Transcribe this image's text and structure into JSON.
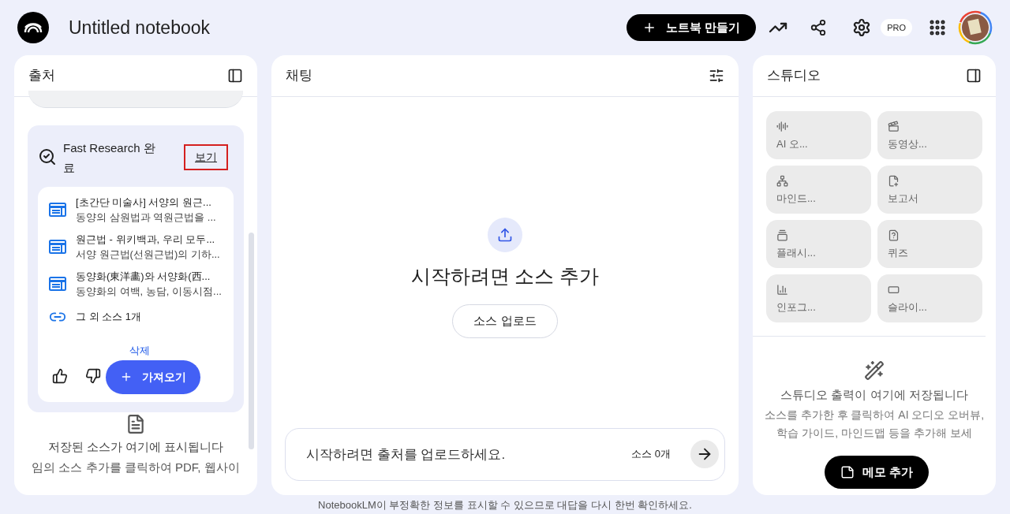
{
  "header": {
    "title": "Untitled notebook",
    "create_button": "노트북 만들기",
    "plan_badge": "PRO"
  },
  "sources": {
    "title": "출처",
    "research": {
      "title": "Fast Research 완료",
      "view_link": "보기",
      "results": [
        {
          "title": "[초간단 미술사] 서양의 원근...",
          "snippet": "동양의 삼원법과 역원근법을 ..."
        },
        {
          "title": "원근법 - 위키백과, 우리 모두...",
          "snippet": "서양 원근법(선원근법)의 기하..."
        },
        {
          "title": "동양화(東洋畵)와 서양화(西...",
          "snippet": "동양화의 여백, 농담, 이동시점..."
        }
      ],
      "more": "그 외 소스 1개",
      "delete": "삭제",
      "import_button": "가져오기"
    },
    "empty_title": "저장된 소스가 여기에 표시됩니다",
    "empty_text": "임의 소스 추가를 클릭하여 PDF, 웹사이"
  },
  "chat": {
    "title": "채팅",
    "empty_title": "시작하려면 소스 추가",
    "upload_button": "소스 업로드",
    "input_placeholder": "시작하려면 출처를 업로드하세요.",
    "source_count": "소스 0개"
  },
  "studio": {
    "title": "스튜디오",
    "tools": [
      {
        "kind": "audio",
        "label": "AI 오..."
      },
      {
        "kind": "video",
        "label": "동영상..."
      },
      {
        "kind": "mindmap",
        "label": "마인드..."
      },
      {
        "kind": "report",
        "label": "보고서"
      },
      {
        "kind": "flashcards",
        "label": "플래시..."
      },
      {
        "kind": "quiz",
        "label": "퀴즈"
      },
      {
        "kind": "infographic",
        "label": "인포그..."
      },
      {
        "kind": "slides",
        "label": "슬라이..."
      }
    ],
    "empty_title": "스튜디오 출력이 여기에 저장됩니다",
    "empty_text": "소스를 추가한 후 클릭하여 AI 오디오 오버뷰, 학습 가이드, 마인드맵 등을 추가해 보세",
    "note_button": "메모 추가"
  },
  "disclaimer": "NotebookLM이 부정확한 정보를 표시할 수 있으므로 대답을 다시 한번 확인하세요."
}
